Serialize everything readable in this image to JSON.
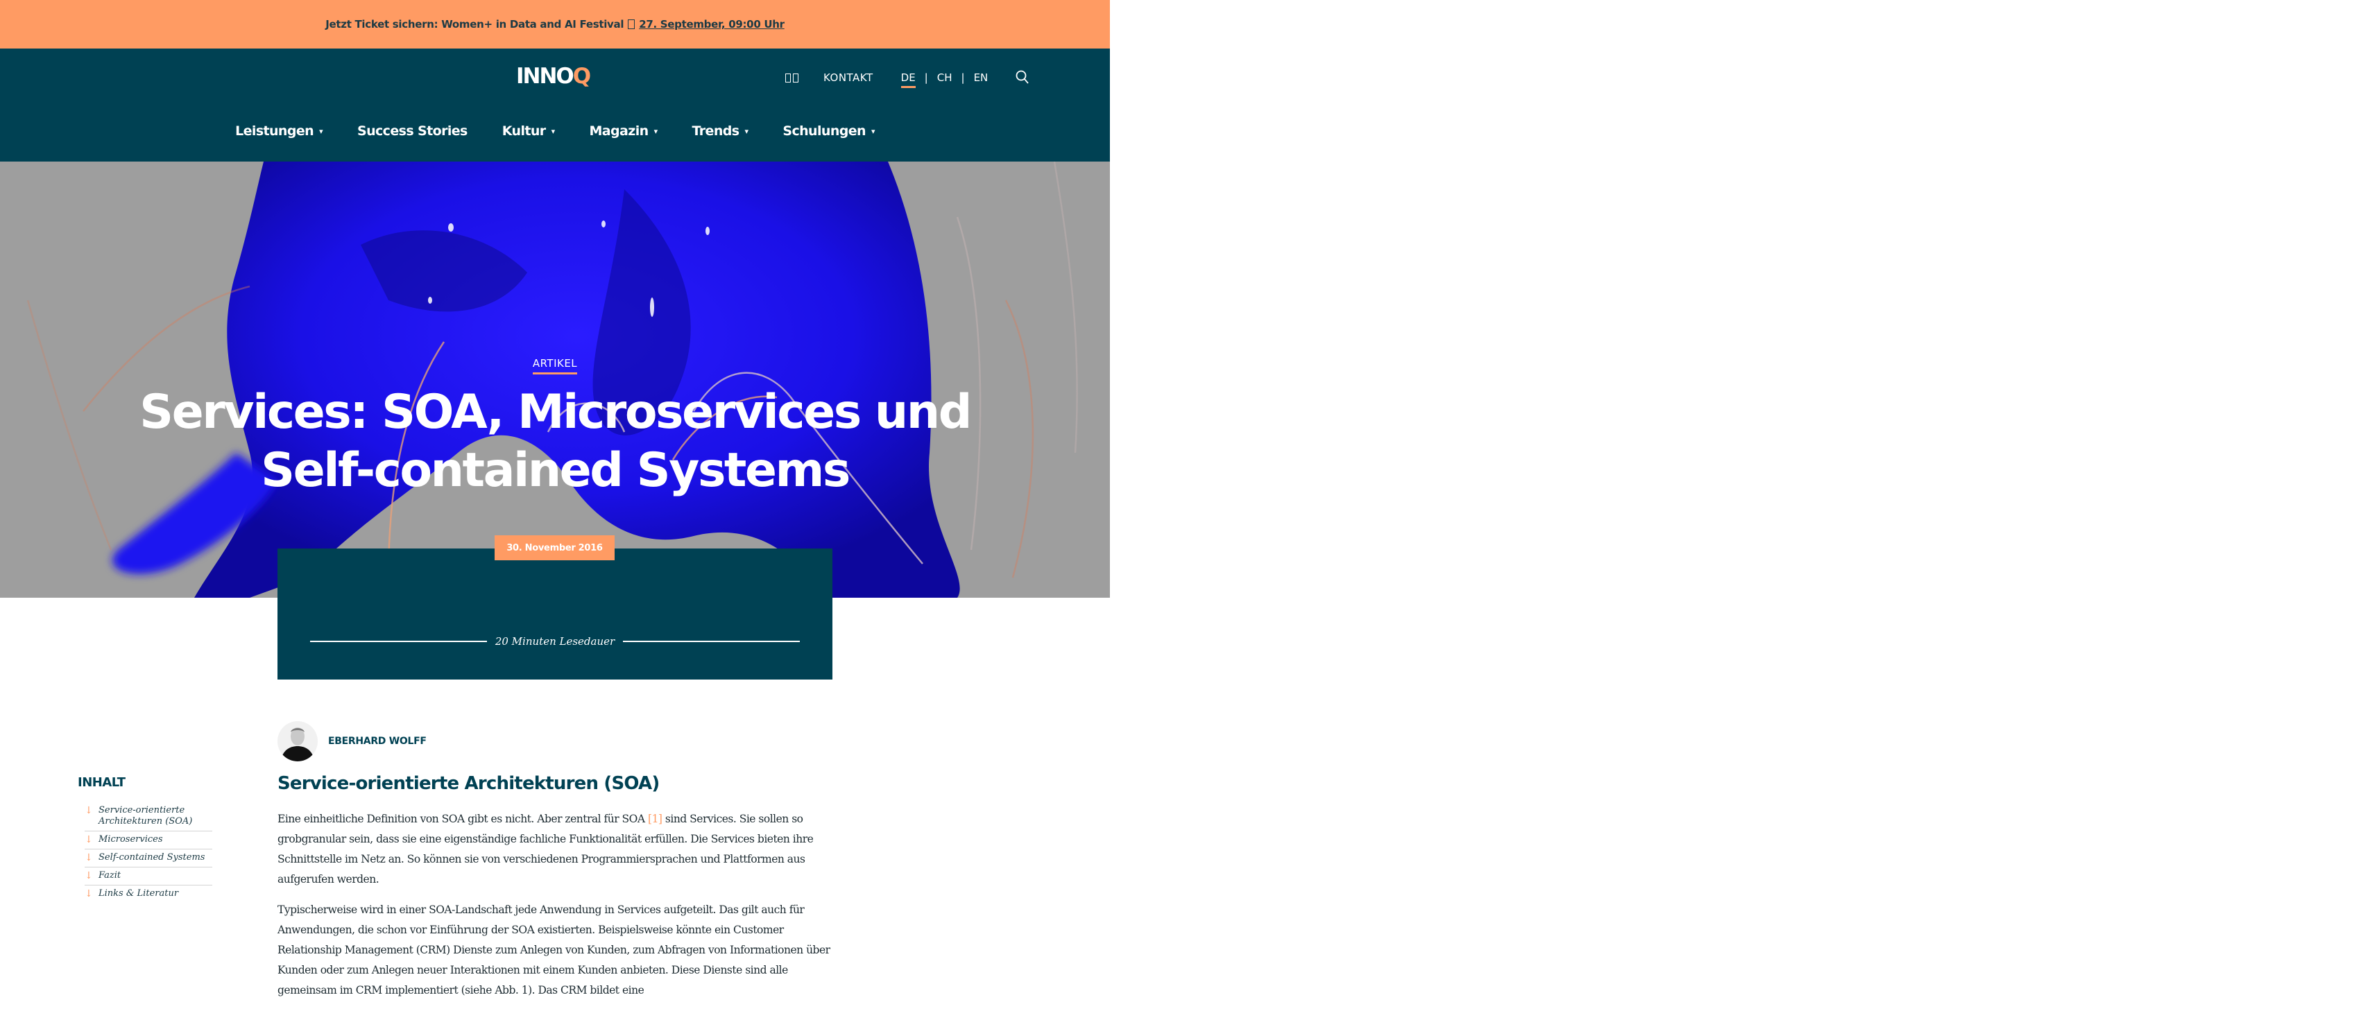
{
  "announcement": {
    "text": "Jetzt Ticket sichern: Women+ in Data and AI Festival",
    "link": "27. September, 09:00 Uhr",
    "bg_color": "#ff9b63"
  },
  "header": {
    "logo_main": "INNO",
    "logo_accent": "Q",
    "utility": {
      "contact": "KONTAKT",
      "languages": [
        {
          "label": "DE",
          "active": true
        },
        {
          "label": "CH",
          "active": false
        },
        {
          "label": "EN",
          "active": false
        }
      ],
      "separator": "|",
      "search_icon": "search-icon"
    },
    "nav": [
      {
        "label": "Leistungen",
        "dropdown": true
      },
      {
        "label": "Success Stories",
        "dropdown": false
      },
      {
        "label": "Kultur",
        "dropdown": true
      },
      {
        "label": "Magazin",
        "dropdown": true
      },
      {
        "label": "Trends",
        "dropdown": true
      },
      {
        "label": "Schulungen",
        "dropdown": true
      }
    ],
    "caret": "▾",
    "bg_color": "#004153"
  },
  "hero": {
    "kicker": "ARTIKEL",
    "title": "Services: SOA, Microservices und Self-contained Systems"
  },
  "meta": {
    "date": "30. November 2016",
    "reading_time": "20 Minuten Lesedauer"
  },
  "author": {
    "name": "EBERHARD WOLFF"
  },
  "toc": {
    "heading": "INHALT",
    "arrow": "↓",
    "items": [
      {
        "label": "Service-orientierte Architekturen (SOA)"
      },
      {
        "label": "Microservices"
      },
      {
        "label": "Self-contained Systems"
      },
      {
        "label": "Fazit"
      },
      {
        "label": "Links & Literatur"
      }
    ]
  },
  "article": {
    "section_title": "Service-orientierte Architekturen (SOA)",
    "p1_before": "Eine einheitliche Definition von SOA gibt es nicht. Aber zentral für SOA ",
    "p1_ref": "[1]",
    "p1_after": " sind Services. Sie sollen so grobgranular sein, dass sie eine eigenständige fachliche Funktionalität erfüllen. Die Services bieten ihre Schnittstelle im Netz an. So können sie von verschiedenen Programmiersprachen und Plattformen aus aufgerufen werden.",
    "p2": "Typischerweise wird in einer SOA-Landschaft jede Anwendung in Services aufgeteilt. Das gilt auch für Anwendungen, die schon vor Einführung der SOA existierten. Beispielsweise könnte ein Customer Relationship Management (CRM) Dienste zum Anlegen von Kunden, zum Abfragen von Informationen über Kunden oder zum Anlegen neuer Interaktionen mit einem Kunden anbieten. Diese Dienste sind alle gemeinsam im CRM implementiert (siehe Abb. 1). Das CRM bildet eine"
  },
  "colors": {
    "accent": "#ff9b63",
    "brand_dark": "#004153",
    "hero_bg": "#9e9e9e",
    "hero_blue": "#1a0fe0"
  }
}
